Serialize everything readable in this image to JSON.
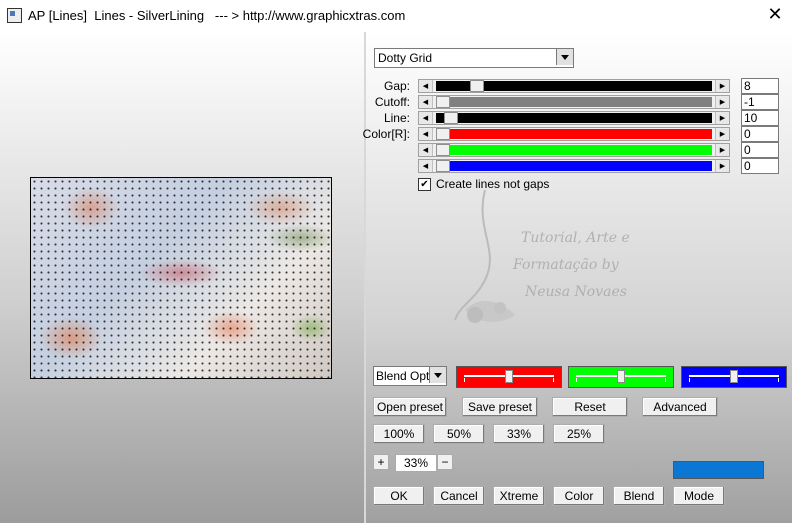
{
  "window": {
    "title": "AP [Lines]  Lines - SilverLining   --- > http://www.graphicxtras.com",
    "close_symbol": "✕"
  },
  "preset": {
    "selected": "Dotty Grid"
  },
  "sliders": [
    {
      "label": "Gap:",
      "value": "8",
      "fill_color": "#000000",
      "thumb_fraction": 0.13
    },
    {
      "label": "Cutoff:",
      "value": "-1",
      "fill_color": "#808080",
      "thumb_fraction": 0.0
    },
    {
      "label": "Line:",
      "value": "10",
      "fill_color": "#000000",
      "thumb_fraction": 0.03
    },
    {
      "label": "Color[R]:",
      "value": "0",
      "fill_color": "#ff0000",
      "thumb_fraction": 0.0
    },
    {
      "label": "",
      "value": "0",
      "fill_color": "#00ff00",
      "thumb_fraction": 0.0
    },
    {
      "label": "",
      "value": "0",
      "fill_color": "#0000ff",
      "thumb_fraction": 0.0
    }
  ],
  "create_lines": {
    "label": "Create lines not gaps",
    "checked": true,
    "check_symbol": "✔"
  },
  "watermark": {
    "line1": "Tutorial, Arte e",
    "line2": "Formatação by",
    "line3": "Neusa Novaes"
  },
  "blend": {
    "selected": "Blend Options",
    "bars": [
      {
        "color": "#ff0000",
        "level": 0.5
      },
      {
        "color": "#00ff00",
        "level": 0.5
      },
      {
        "color": "#0000ff",
        "level": 0.5
      }
    ]
  },
  "buttons": {
    "open_preset": "Open preset",
    "save_preset": "Save preset",
    "reset": "Reset",
    "advanced": "Advanced",
    "zoom100": "100%",
    "zoom50": "50%",
    "zoom33": "33%",
    "zoom25": "25%",
    "ok": "OK",
    "cancel": "Cancel",
    "xtreme": "Xtreme",
    "color": "Color",
    "blend": "Blend",
    "mode": "Mode"
  },
  "zoom": {
    "value": "33%",
    "plus": "+",
    "minus": "−"
  },
  "color_swatch": "#0a77d4"
}
